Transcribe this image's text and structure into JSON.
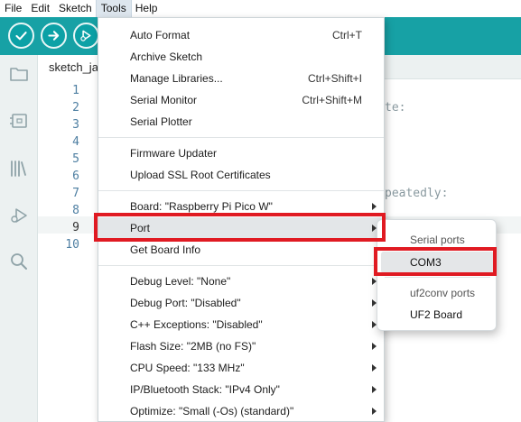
{
  "menubar": {
    "items": [
      {
        "label": "File"
      },
      {
        "label": "Edit"
      },
      {
        "label": "Sketch"
      },
      {
        "label": "Tools"
      },
      {
        "label": "Help"
      }
    ]
  },
  "toolbar": {
    "buttons": [
      "check-icon",
      "arrow-right-icon",
      "debug-icon"
    ],
    "accent_color": "#17a1a5"
  },
  "sidebar": {
    "icons": [
      "folder-icon",
      "board-icon",
      "library-icon",
      "debug-icon",
      "search-icon"
    ]
  },
  "tab": {
    "label": "sketch_ja"
  },
  "editor": {
    "line_numbers": [
      "1",
      "2",
      "3",
      "4",
      "5",
      "6",
      "7",
      "8",
      "9",
      "10"
    ],
    "code_fragments": {
      "line2": "te:",
      "line7": "peatedly:"
    }
  },
  "tools_menu": {
    "items": [
      {
        "label": "Auto Format",
        "shortcut": "Ctrl+T"
      },
      {
        "label": "Archive Sketch",
        "shortcut": ""
      },
      {
        "label": "Manage Libraries...",
        "shortcut": "Ctrl+Shift+I"
      },
      {
        "label": "Serial Monitor",
        "shortcut": "Ctrl+Shift+M"
      },
      {
        "label": "Serial Plotter",
        "shortcut": ""
      },
      {
        "label": "Firmware Updater",
        "shortcut": ""
      },
      {
        "label": "Upload SSL Root Certificates",
        "shortcut": ""
      },
      {
        "label": "Board: \"Raspberry Pi Pico W\"",
        "submenu": true
      },
      {
        "label": "Port",
        "submenu": true,
        "highlighted": true
      },
      {
        "label": "Get Board Info",
        "shortcut": ""
      },
      {
        "label": "Debug Level: \"None\"",
        "submenu": true
      },
      {
        "label": "Debug Port: \"Disabled\"",
        "submenu": true
      },
      {
        "label": "C++ Exceptions: \"Disabled\"",
        "submenu": true
      },
      {
        "label": "Flash Size: \"2MB (no FS)\"",
        "submenu": true
      },
      {
        "label": "CPU Speed: \"133 MHz\"",
        "submenu": true
      },
      {
        "label": "IP/Bluetooth Stack: \"IPv4 Only\"",
        "submenu": true
      },
      {
        "label": "Optimize: \"Small (-Os) (standard)\"",
        "submenu": true
      }
    ]
  },
  "port_submenu": {
    "serial_header": "Serial ports",
    "serial_port": "COM3",
    "uf2_header": "uf2conv ports",
    "uf2_port": "UF2 Board"
  },
  "annotation_color": "#e01a22"
}
